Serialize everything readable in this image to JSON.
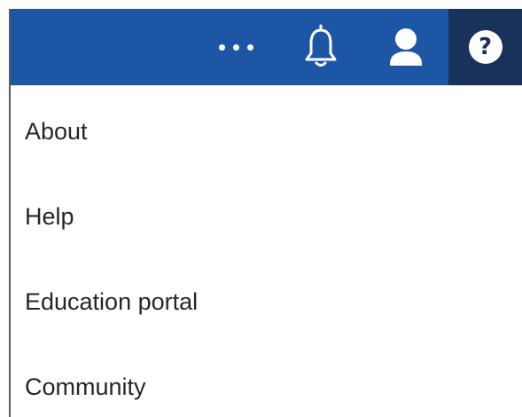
{
  "topbar": {
    "icons": {
      "more": "more-horizontal-icon",
      "notifications": "bell-icon",
      "user": "user-icon",
      "help": "help-icon",
      "help_glyph": "?"
    },
    "colors": {
      "bar_background": "#1e56a6",
      "active_button_background": "#18325a",
      "icon": "#ffffff"
    }
  },
  "help_menu": {
    "items": [
      {
        "label": "About"
      },
      {
        "label": "Help"
      },
      {
        "label": "Education portal"
      },
      {
        "label": "Community"
      }
    ]
  }
}
